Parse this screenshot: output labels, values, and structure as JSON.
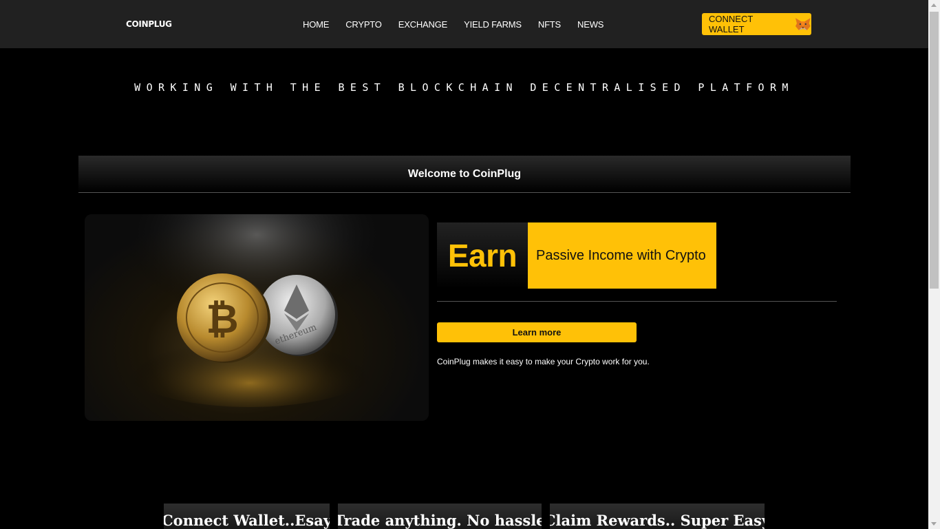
{
  "navbar": {
    "brand": "COINPLUG",
    "links": [
      "HOME",
      "CRYPTO",
      "EXCHANGE",
      "YIELD FARMS",
      "NFTS",
      "NEWS"
    ],
    "wallet_button": "CONNECT WALLET"
  },
  "hero": {
    "tagline": "WORKING WITH THE BEST BLOCKCHAIN DECENTRALISED PLATFORM",
    "welcome": "Welcome to CoinPlug"
  },
  "promo": {
    "earn": "Earn",
    "earn_caption": "Passive Income with Crypto",
    "learn_more": "Learn more",
    "description": "CoinPlug makes it easy to make your Crypto work for you.",
    "coin_ethereum_text": "ethereum"
  },
  "features": [
    "Connect Wallet..Esay",
    "Trade anything. No hassle",
    "Claim Rewards.. Super Easy"
  ],
  "colors": {
    "accent": "#ffc107",
    "navbar": "#212121",
    "background": "#000000"
  },
  "icons": {
    "wallet": "metamask-fox-icon"
  }
}
